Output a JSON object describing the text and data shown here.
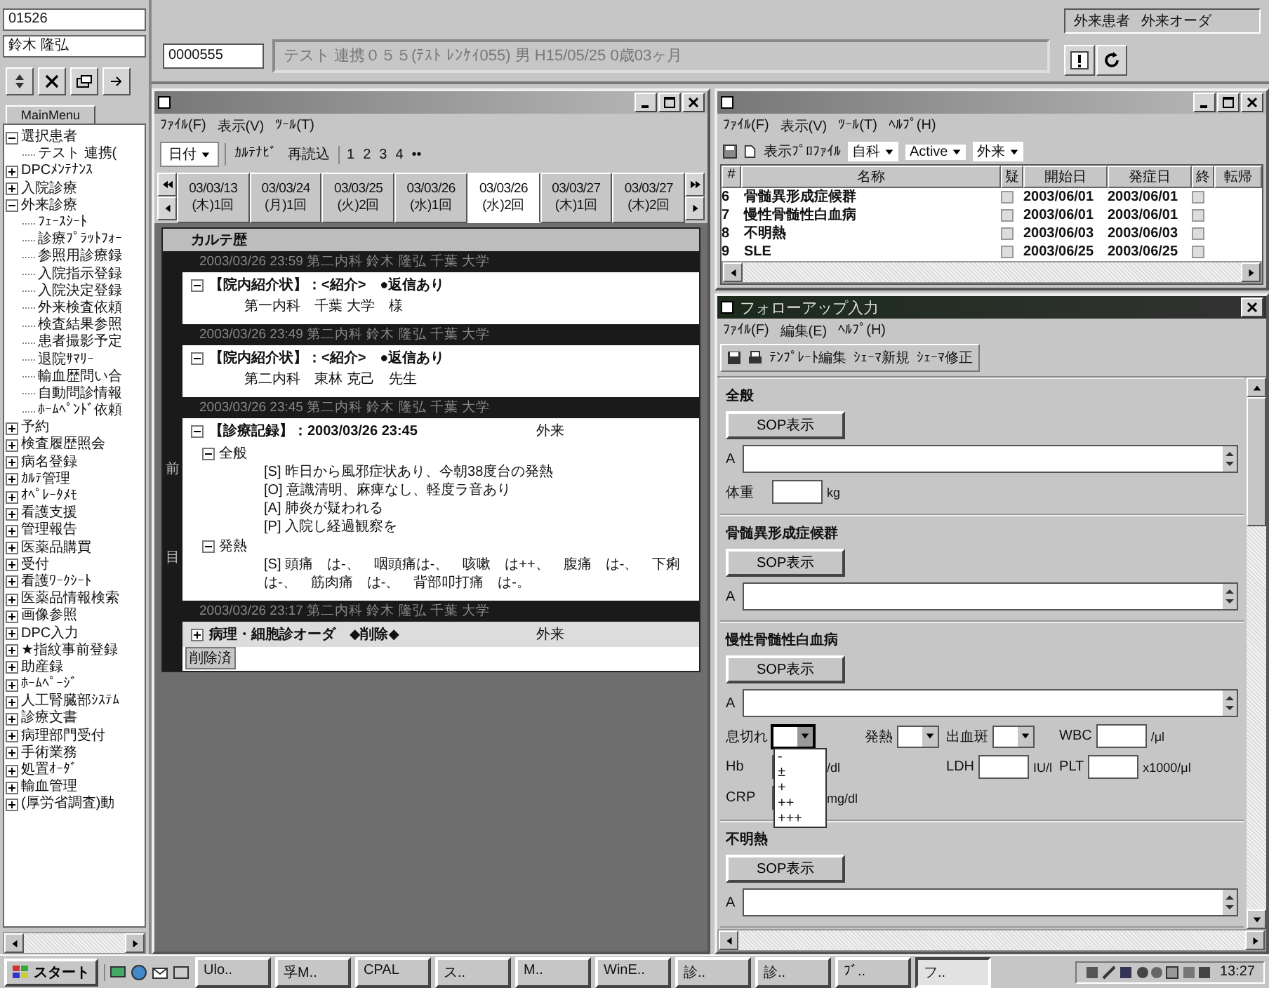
{
  "sidebar": {
    "user_id": "01526",
    "user_name": "鈴木 隆弘",
    "tab": "MainMenu",
    "tree": [
      {
        "label": "選択患者",
        "expanded": true,
        "children": [
          {
            "label": "テスト 連携("
          }
        ]
      },
      {
        "label": "DPCﾒﾝﾃﾅﾝｽ",
        "expanded": false
      },
      {
        "label": "入院診療",
        "expanded": false
      },
      {
        "label": "外来診療",
        "expanded": true,
        "children": [
          {
            "label": "ﾌｪｰｽｼｰﾄ"
          },
          {
            "label": "診療ﾌﾟﾗｯﾄﾌｫｰ"
          },
          {
            "label": "参照用診療録"
          },
          {
            "label": "入院指示登録"
          },
          {
            "label": "入院決定登録"
          },
          {
            "label": "外来検査依頼"
          },
          {
            "label": "検査結果参照"
          },
          {
            "label": "患者撮影予定"
          },
          {
            "label": "退院ｻﾏﾘｰ"
          },
          {
            "label": "輸血歴問い合"
          },
          {
            "label": "自動問診情報"
          },
          {
            "label": "ﾎｰﾑﾍﾟﾝﾄﾞ依頼"
          }
        ]
      },
      {
        "label": "予約",
        "expanded": false
      },
      {
        "label": "検査履歴照会",
        "expanded": false
      },
      {
        "label": "病名登録",
        "expanded": false
      },
      {
        "label": "ｶﾙﾃ管理",
        "expanded": false
      },
      {
        "label": "ｵﾍﾟﾚｰﾀﾒﾓ",
        "expanded": false
      },
      {
        "label": "看護支援",
        "expanded": false
      },
      {
        "label": "管理報告",
        "expanded": false
      },
      {
        "label": "医薬品購買",
        "expanded": false
      },
      {
        "label": "受付",
        "expanded": false
      },
      {
        "label": "看護ﾜｰｸｼｰﾄ",
        "expanded": false
      },
      {
        "label": "医薬品情報検索",
        "expanded": false
      },
      {
        "label": "画像参照",
        "expanded": false
      },
      {
        "label": "DPC入力",
        "expanded": false
      },
      {
        "label": "★指紋事前登録",
        "expanded": false
      },
      {
        "label": "助産録",
        "expanded": false
      },
      {
        "label": "ﾎｰﾑﾍﾟｰｼﾞ",
        "expanded": false
      },
      {
        "label": "人工腎臓部ｼｽﾃﾑ",
        "expanded": false
      },
      {
        "label": "診療文書",
        "expanded": false
      },
      {
        "label": "病理部門受付",
        "expanded": false
      },
      {
        "label": "手術業務",
        "expanded": false
      },
      {
        "label": "処置ｵｰﾀﾞ",
        "expanded": false
      },
      {
        "label": "輸血管理",
        "expanded": false
      },
      {
        "label": "(厚労省調査)動",
        "expanded": false
      }
    ]
  },
  "header": {
    "patient_id": "0000555",
    "patient_info": "テスト 連携０５５(ﾃｽﾄ ﾚﾝｹｲ055) 男 H15/05/25 0歳03ヶ月",
    "mode_labels": [
      "外来患者",
      "外来オーダ"
    ]
  },
  "karte_window": {
    "menu": [
      "ﾌｧｲﾙ(F)",
      "表示(V)",
      "ﾂｰﾙ(T)"
    ],
    "date_select": "日付",
    "buttons": [
      "ｶﾙﾃﾅﾋﾞ",
      "再読込"
    ],
    "pages": [
      "1",
      "2",
      "3",
      "4",
      "••"
    ],
    "date_tabs": [
      {
        "date": "03/03/13",
        "day": "(木)1回",
        "selected": false
      },
      {
        "date": "03/03/24",
        "day": "(月)1回",
        "selected": false
      },
      {
        "date": "03/03/25",
        "day": "(火)2回",
        "selected": false
      },
      {
        "date": "03/03/26",
        "day": "(水)1回",
        "selected": false
      },
      {
        "date": "03/03/26",
        "day": "(水)2回",
        "selected": true
      },
      {
        "date": "03/03/27",
        "day": "(木)1回",
        "selected": false
      },
      {
        "date": "03/03/27",
        "day": "(木)2回",
        "selected": false
      }
    ],
    "history_title": "カルテ歴",
    "entries": [
      {
        "header": "2003/03/26 23:59 第二内科 鈴木 隆弘 千葉 大学",
        "title": "【院内紹介状】：<紹介>　●返信あり",
        "expanded": true,
        "children": [
          {
            "text": "第一内科　千葉 大学　様"
          }
        ]
      },
      {
        "header": "2003/03/26 23:49 第二内科 鈴木 隆弘 千葉 大学",
        "title": "【院内紹介状】：<紹介>　●返信あり",
        "expanded": true,
        "children": [
          {
            "text": "第二内科　東林 克己　先生"
          }
        ]
      },
      {
        "header": "2003/03/26 23:45 第二内科 鈴木 隆弘 千葉 大学",
        "title": "【診療記録】：2003/03/26 23:45",
        "place": "外来",
        "gutter": [
          "前",
          "目"
        ],
        "expanded": true,
        "children": [
          {
            "label": "全般",
            "expanded": true,
            "children": [
              {
                "text": "[S] 昨日から風邪症状あり、今朝38度台の発熱"
              },
              {
                "text": "[O] 意識清明、麻痺なし、軽度ラ音あり"
              },
              {
                "text": "[A] 肺炎が疑われる"
              },
              {
                "text": "[P] 入院し経過観察を"
              }
            ]
          },
          {
            "label": "発熱",
            "expanded": true,
            "children": [
              {
                "text": "[S] 頭痛　は-、　咽頭痛は-、　咳嗽　は++、　腹痛　は-、　下痢は-、　筋肉痛　は-、　背部叩打痛　は-。"
              }
            ]
          }
        ]
      },
      {
        "header": "2003/03/26 23:17 第二内科 鈴木 隆弘 千葉 大学",
        "title": "病理・細胞診オーダ　◆削除◆",
        "place": "外来",
        "expanded": false,
        "tag": "削除済"
      }
    ]
  },
  "disease_window": {
    "menu": [
      "ﾌｧｲﾙ(F)",
      "表示(V)",
      "ﾂｰﾙ(T)",
      "ﾍﾙﾌﾟ(H)"
    ],
    "profile_label": "表示ﾌﾟﾛﾌｧｲﾙ",
    "filters": [
      "自科",
      "Active",
      "外来"
    ],
    "columns": [
      "#",
      "名称",
      "疑",
      "開始日",
      "発症日",
      "終",
      "転帰"
    ],
    "rows": [
      {
        "no": "6",
        "name": "骨髄異形成症候群",
        "start": "2003/06/01",
        "onset": "2003/06/01"
      },
      {
        "no": "7",
        "name": "慢性骨髄性白血病",
        "start": "2003/06/01",
        "onset": "2003/06/01"
      },
      {
        "no": "8",
        "name": "不明熱",
        "start": "2003/06/03",
        "onset": "2003/06/03"
      },
      {
        "no": "9",
        "name": "SLE",
        "start": "2003/06/25",
        "onset": "2003/06/25"
      }
    ]
  },
  "followup_window": {
    "title": "フォローアップ入力",
    "menu": [
      "ﾌｧｲﾙ(F)",
      "編集(E)",
      "ﾍﾙﾌﾟ(H)"
    ],
    "toolbar": [
      "ﾃﾝﾌﾟﾚｰﾄ編集",
      "ｼｪｰﾏ新規",
      "ｼｪｰﾏ修正"
    ],
    "sections": [
      {
        "title": "全般",
        "button": "SOP表示",
        "rows": [
          [
            {
              "kind": "memo",
              "label": "A"
            }
          ],
          [
            {
              "kind": "number",
              "label": "体重",
              "unit": "kg"
            }
          ]
        ]
      },
      {
        "title": "骨髄異形成症候群",
        "button": "SOP表示",
        "rows": [
          [
            {
              "kind": "memo",
              "label": "A"
            }
          ]
        ]
      },
      {
        "title": "慢性骨髄性白血病",
        "button": "SOP表示",
        "rows": [
          [
            {
              "kind": "memo",
              "label": "A"
            }
          ],
          [
            {
              "kind": "select",
              "label": "息切れ",
              "open": true,
              "options": [
                "-",
                "±",
                "+",
                "++",
                "+++"
              ]
            },
            {
              "kind": "select",
              "label": "発熱",
              "open": false
            },
            {
              "kind": "select",
              "label": "出血斑",
              "open": false
            },
            {
              "kind": "number",
              "label": "WBC",
              "unit": "/μl"
            }
          ],
          [
            {
              "kind": "number",
              "label": "Hb",
              "unit": "/dl"
            },
            "",
            {
              "kind": "number",
              "label": "LDH",
              "unit": "IU/l"
            },
            {
              "kind": "number",
              "label": "PLT",
              "unit": "x1000/μl"
            }
          ],
          [
            {
              "kind": "number",
              "label": "CRP",
              "unit": "mg/dl"
            }
          ]
        ]
      },
      {
        "title": "不明熱",
        "button": "SOP表示",
        "rows": [
          [
            {
              "kind": "memo",
              "label": "A"
            }
          ]
        ]
      }
    ]
  },
  "taskbar": {
    "start": "スタート",
    "tasks": [
      {
        "label": "Ulo..",
        "selected": false
      },
      {
        "label": "孚M..",
        "selected": false
      },
      {
        "label": "CPAL",
        "selected": false
      },
      {
        "label": "ス..",
        "selected": false
      },
      {
        "label": "M..",
        "selected": false
      },
      {
        "label": "WinE..",
        "selected": false
      },
      {
        "label": "診..",
        "selected": false
      },
      {
        "label": "診..",
        "selected": false
      },
      {
        "label": "ﾌﾞ..",
        "selected": false
      },
      {
        "label": "フ..",
        "selected": true
      }
    ],
    "clock": "13:27"
  }
}
